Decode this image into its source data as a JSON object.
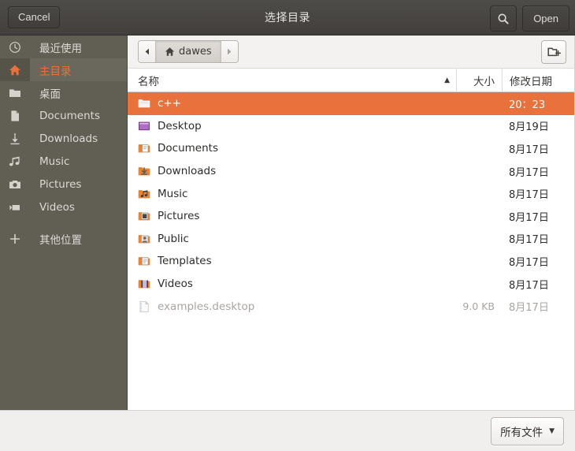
{
  "header": {
    "cancel_label": "Cancel",
    "title": "选择目录",
    "open_label": "Open",
    "search_icon": "search-icon"
  },
  "sidebar": {
    "items": [
      {
        "label": "最近使用",
        "icon": "clock-icon",
        "active": false
      },
      {
        "label": "主目录",
        "icon": "home-icon",
        "active": true
      },
      {
        "label": "桌面",
        "icon": "folder-icon",
        "active": false
      },
      {
        "label": "Documents",
        "icon": "document-icon",
        "active": false
      },
      {
        "label": "Downloads",
        "icon": "download-arrow-icon",
        "active": false
      },
      {
        "label": "Music",
        "icon": "music-note-icon",
        "active": false
      },
      {
        "label": "Pictures",
        "icon": "camera-icon",
        "active": false
      },
      {
        "label": "Videos",
        "icon": "video-camera-icon",
        "active": false
      },
      {
        "label": "其他位置",
        "icon": "plus-icon",
        "active": false
      }
    ]
  },
  "pathbar": {
    "back_icon": "chevron-left-icon",
    "forward_icon": "chevron-right-icon",
    "crumb_label": "dawes",
    "crumb_icon": "home-icon",
    "new_folder_icon": "new-folder-icon"
  },
  "columns": {
    "name": "名称",
    "size": "大小",
    "modified": "修改日期",
    "sort_indicator": "▲"
  },
  "files": [
    {
      "name": "c++",
      "size": "",
      "modified": "20：23",
      "icon": "folder-plain-icon",
      "selected": true,
      "dim": false
    },
    {
      "name": "Desktop",
      "size": "",
      "modified": "8月19日",
      "icon": "folder-desktop-icon",
      "selected": false,
      "dim": false
    },
    {
      "name": "Documents",
      "size": "",
      "modified": "8月17日",
      "icon": "folder-documents-icon",
      "selected": false,
      "dim": false
    },
    {
      "name": "Downloads",
      "size": "",
      "modified": "8月17日",
      "icon": "folder-downloads-icon",
      "selected": false,
      "dim": false
    },
    {
      "name": "Music",
      "size": "",
      "modified": "8月17日",
      "icon": "folder-music-icon",
      "selected": false,
      "dim": false
    },
    {
      "name": "Pictures",
      "size": "",
      "modified": "8月17日",
      "icon": "folder-pictures-icon",
      "selected": false,
      "dim": false
    },
    {
      "name": "Public",
      "size": "",
      "modified": "8月17日",
      "icon": "folder-public-icon",
      "selected": false,
      "dim": false
    },
    {
      "name": "Templates",
      "size": "",
      "modified": "8月17日",
      "icon": "folder-templates-icon",
      "selected": false,
      "dim": false
    },
    {
      "name": "Videos",
      "size": "",
      "modified": "8月17日",
      "icon": "folder-videos-icon",
      "selected": false,
      "dim": false
    },
    {
      "name": "examples.desktop",
      "size": "9.0 KB",
      "modified": "8月17日",
      "icon": "text-file-icon",
      "selected": false,
      "dim": true
    }
  ],
  "footer": {
    "filter_label": "所有文件",
    "filter_caret": "▼"
  },
  "colors": {
    "selection": "#e8713c",
    "sidebar_bg": "#615e54",
    "header_bg": "#443f3c",
    "accent": "#e8713c",
    "footer_bg": "#f0efee"
  }
}
